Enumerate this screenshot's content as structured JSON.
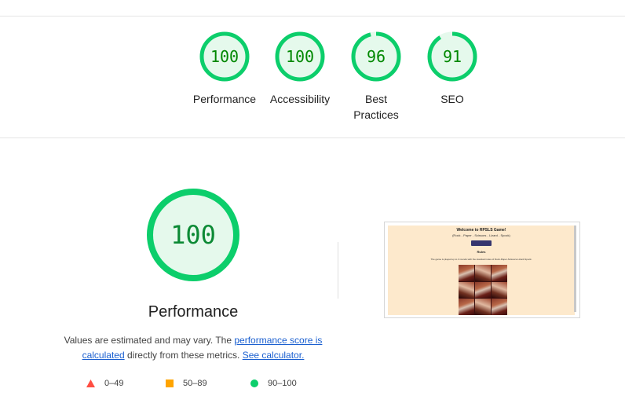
{
  "colors": {
    "pass": "#0cce6b",
    "pass_fill": "#e5f9ec",
    "pass_text": "#008800",
    "average": "#ffa400",
    "fail": "#ff4e42",
    "link": "#1a5fd0"
  },
  "categories": [
    {
      "label": "Performance",
      "score": 100
    },
    {
      "label": "Accessibility",
      "score": 100
    },
    {
      "label": "Best Practices",
      "score": 96
    },
    {
      "label": "SEO",
      "score": 91
    }
  ],
  "main": {
    "score": 100,
    "title": "Performance",
    "desc_prefix": "Values are estimated and may vary. The ",
    "link_score": "performance score is calculated",
    "desc_mid": " directly from these metrics. ",
    "link_calc": "See calculator."
  },
  "legend": [
    {
      "range": "0–49",
      "shape": "triangle-icon"
    },
    {
      "range": "50–89",
      "shape": "square-icon"
    },
    {
      "range": "90–100",
      "shape": "circle-icon"
    }
  ],
  "screenshot": {
    "title": "Welcome to RPSLS Game!",
    "subtitle": "(Rock - Paper - Scissors - Lizard - Spock)",
    "section": "Rules",
    "text": "The game is played up to 3 rounds with the standard rules of Rock-Paper-Scissors-Lizard-Spock."
  }
}
